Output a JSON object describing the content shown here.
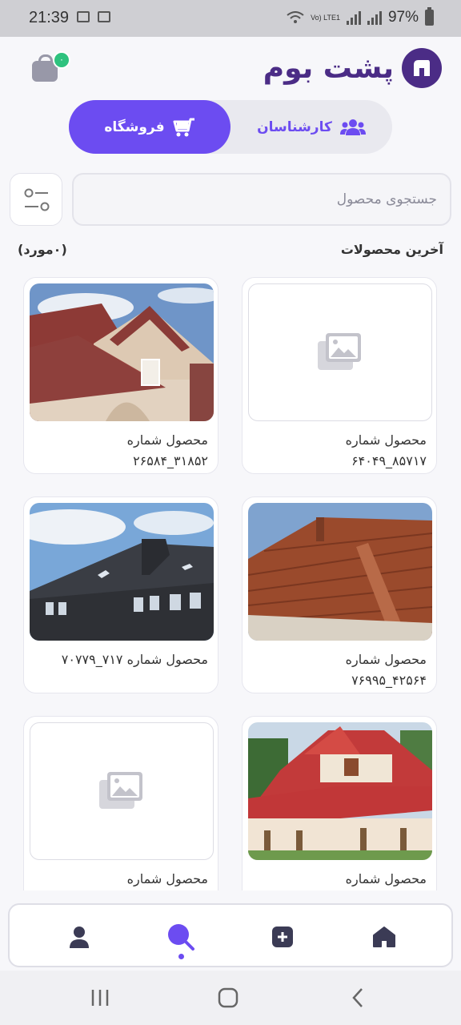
{
  "status_bar": {
    "time": "21:39",
    "battery": "97%",
    "network": "Vo) LTE1"
  },
  "header": {
    "brand_name": "پشت بوم",
    "cart_badge": "۰"
  },
  "toggle": {
    "store_label": "فروشگاه",
    "experts_label": "کارشناسان"
  },
  "search": {
    "placeholder": "جستجوی محصول"
  },
  "section": {
    "title": "آخرین محصولات",
    "count": "(۰مورد)"
  },
  "products": [
    {
      "title": "محصول شماره",
      "code": "۸۵۷۱۷_۶۴۰۴۹",
      "image": "placeholder"
    },
    {
      "title": "محصول شماره",
      "code": "۳۱۸۵۲_۲۶۵۸۴",
      "image": "house-red-roof"
    },
    {
      "title": "محصول شماره",
      "code": "۴۲۵۶۴_۷۶۹۹۵",
      "image": "tile-roof-closeup"
    },
    {
      "title": "محصول شماره  ۷۱۷_۷۰۷۷۹",
      "code": "",
      "image": "dark-roof"
    },
    {
      "title": "محصول شماره",
      "code": "",
      "image": "villa-red-roof"
    },
    {
      "title": "محصول شماره",
      "code": "",
      "image": "placeholder"
    }
  ],
  "bottom_nav": [
    "home-icon",
    "add-icon",
    "search-icon",
    "profile-icon"
  ],
  "colors": {
    "accent": "#6c4cf1",
    "brand": "#4b2c86",
    "badge": "#2ec27e"
  }
}
